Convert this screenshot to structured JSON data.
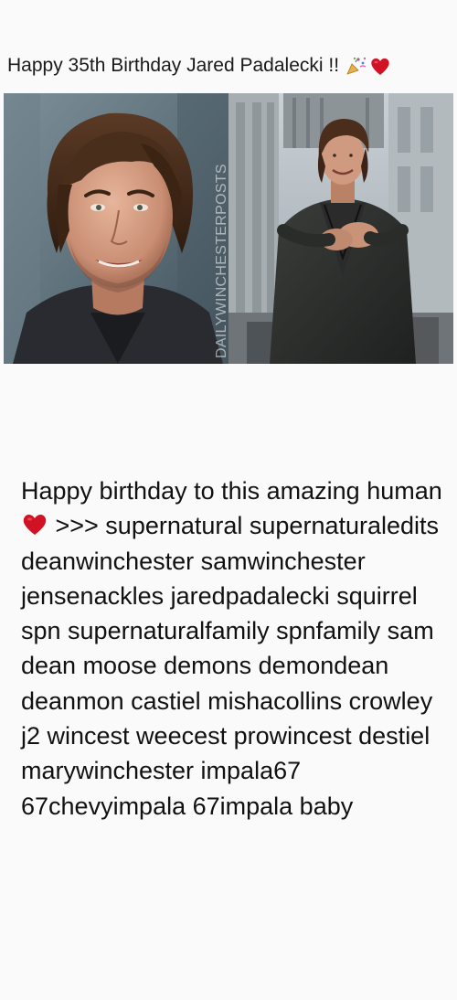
{
  "post": {
    "title": "Happy 35th Birthday Jared Padalecki !!",
    "title_emojis": [
      "party-popper-icon",
      "red-heart-icon"
    ],
    "watermark": "DAILYWINCHESTERPOSTS",
    "caption_before_emoji": "Happy birthday to this amazing human",
    "caption_emoji": "red-heart-icon",
    "caption_after_emoji": " >>> supernatural supernaturaledits deanwinchester samwinchester jensenackles jaredpadalecki squirrel spn supernaturalfamily spnfamily sam dean moose demons demondean deanmon castiel mishacollins crowley j2 wincest weecest prowincest destiel marywinchester impala67 67chevyimpala 67impala baby"
  },
  "colors": {
    "background": "#fafafa",
    "text": "#111111",
    "heart": "#d11124"
  }
}
